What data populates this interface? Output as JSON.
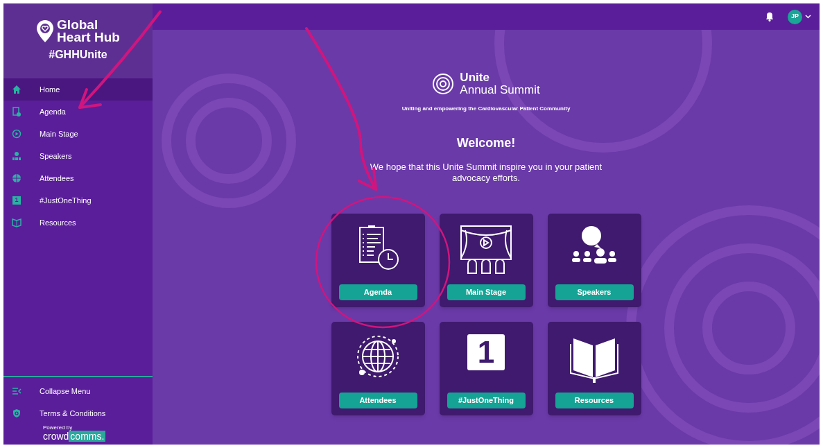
{
  "sidebar": {
    "logo_line1": "Global",
    "logo_line2": "Heart Hub",
    "hashtag": "#GHHUnite",
    "items": [
      {
        "label": "Home",
        "kind": "home",
        "selected": true
      },
      {
        "label": "Agenda",
        "kind": "agenda",
        "selected": false
      },
      {
        "label": "Main Stage",
        "kind": "play",
        "selected": false
      },
      {
        "label": "Speakers",
        "kind": "speakers",
        "selected": false
      },
      {
        "label": "Attendees",
        "kind": "globe",
        "selected": false
      },
      {
        "label": "#JustOneThing",
        "kind": "number",
        "icon_text": "1",
        "selected": false
      },
      {
        "label": "Resources",
        "kind": "book",
        "selected": false
      }
    ],
    "footer_items": [
      {
        "label": "Collapse Menu",
        "kind": "collapse"
      },
      {
        "label": "Terms & Conditions",
        "kind": "shield"
      }
    ],
    "powered_by": "Powered by",
    "brand_part1": "crowd",
    "brand_part2": "comms."
  },
  "header": {
    "avatar_initials": "JP"
  },
  "main": {
    "logo_title": "Unite",
    "logo_subtitle": "Annual Summit",
    "tagline": "Uniting and empowering the Cardiovascular Patient Community",
    "heading": "Welcome!",
    "intro": "We hope that this Unite Summit inspire you in your patient advocacy efforts.",
    "cards": [
      {
        "label": "Agenda",
        "kind": "agenda"
      },
      {
        "label": "Main Stage",
        "kind": "stage"
      },
      {
        "label": "Speakers",
        "kind": "speakers"
      },
      {
        "label": "Attendees",
        "kind": "globe"
      },
      {
        "label": "#JustOneThing",
        "kind": "number",
        "icon_text": "1"
      },
      {
        "label": "Resources",
        "kind": "book"
      }
    ]
  },
  "annotations": [
    {
      "kind": "arrow"
    },
    {
      "kind": "arrow"
    },
    {
      "kind": "circle"
    }
  ]
}
